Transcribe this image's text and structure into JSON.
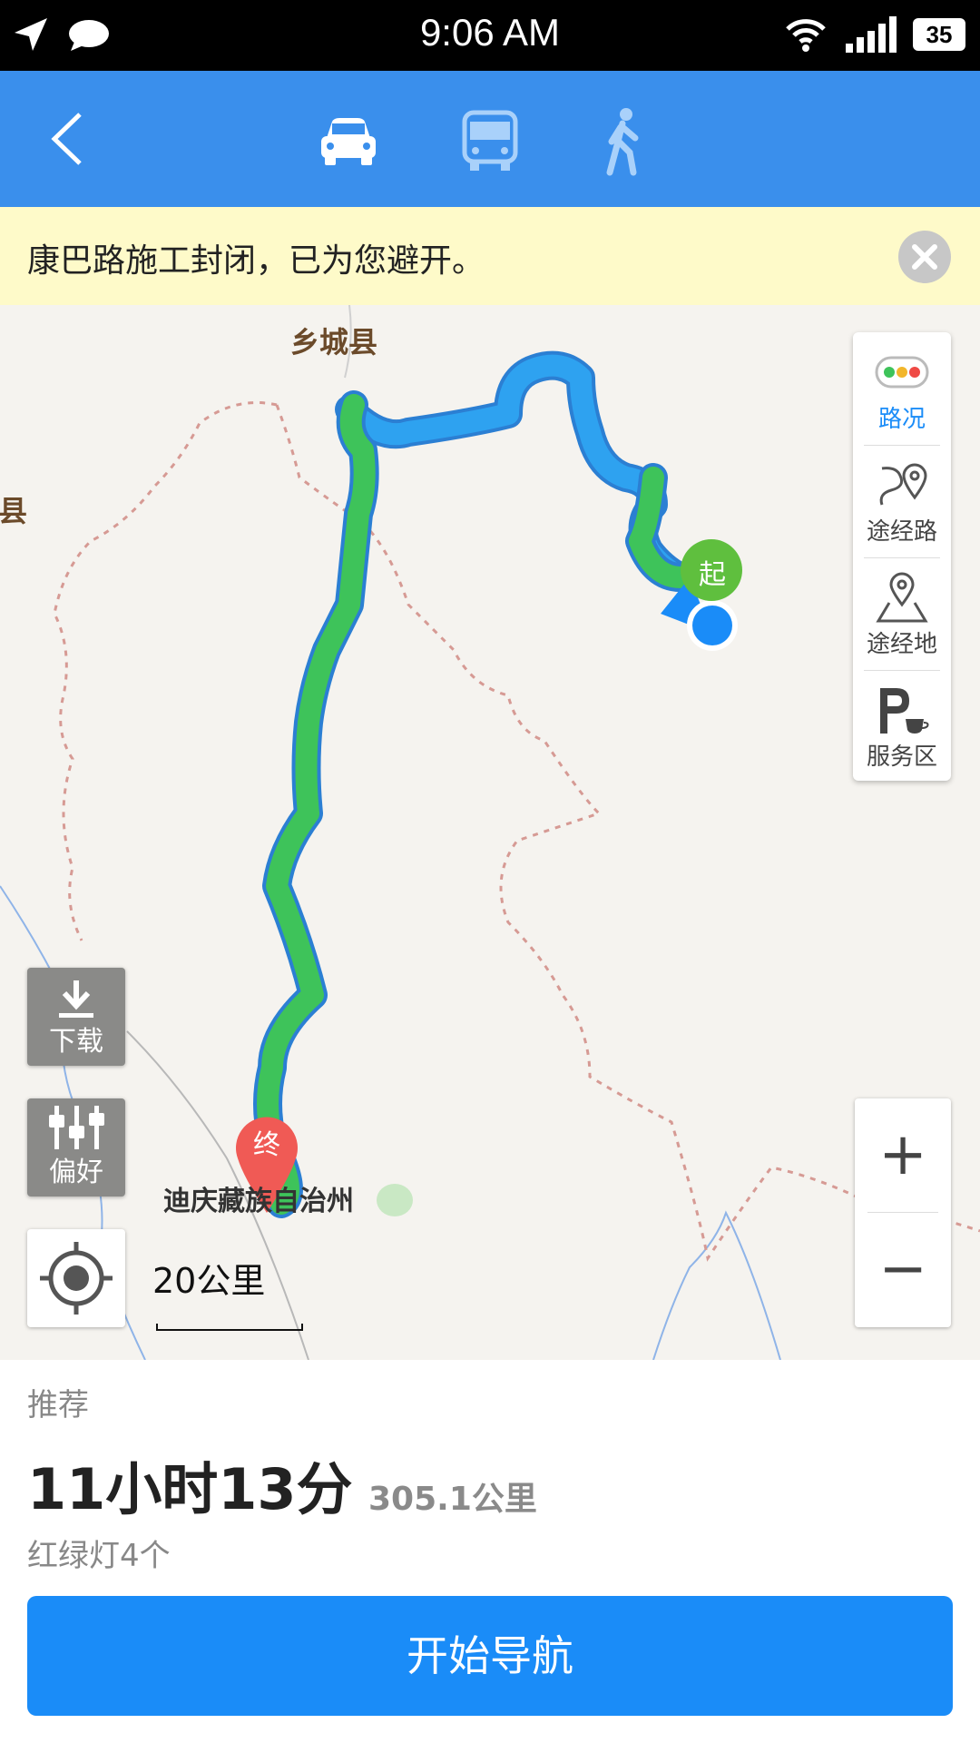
{
  "status_bar": {
    "time": "9:06 AM",
    "battery": "35"
  },
  "nav": {
    "modes": [
      "car",
      "bus",
      "walk"
    ],
    "active_mode": "car"
  },
  "notice": {
    "text": "康巴路施工封闭，已为您避开。"
  },
  "map": {
    "labels": {
      "north_county": "乡城县",
      "west_county": "县",
      "destination": "迪庆藏族自治州"
    },
    "markers": {
      "start": "起",
      "end": "终"
    },
    "side_panel": [
      {
        "label": "路况",
        "icon": "traffic-light-icon"
      },
      {
        "label": "途经路",
        "icon": "via-road-icon"
      },
      {
        "label": "途经地",
        "icon": "via-place-icon"
      },
      {
        "label": "服务区",
        "icon": "service-area-icon"
      }
    ],
    "tools": {
      "download": "下载",
      "preference": "偏好"
    },
    "scale": "20公里",
    "zoom_in": "+",
    "zoom_out": "−"
  },
  "route": {
    "tag": "推荐",
    "duration": "11小时13分",
    "distance": "305.1公里",
    "traffic_lights": "红绿灯4个"
  },
  "start_button": "开始导航",
  "colors": {
    "nav_blue": "#3a8fec",
    "route_green": "#3ec35a",
    "route_blue": "#2ea2f0",
    "button_blue": "#1a8cf8"
  }
}
